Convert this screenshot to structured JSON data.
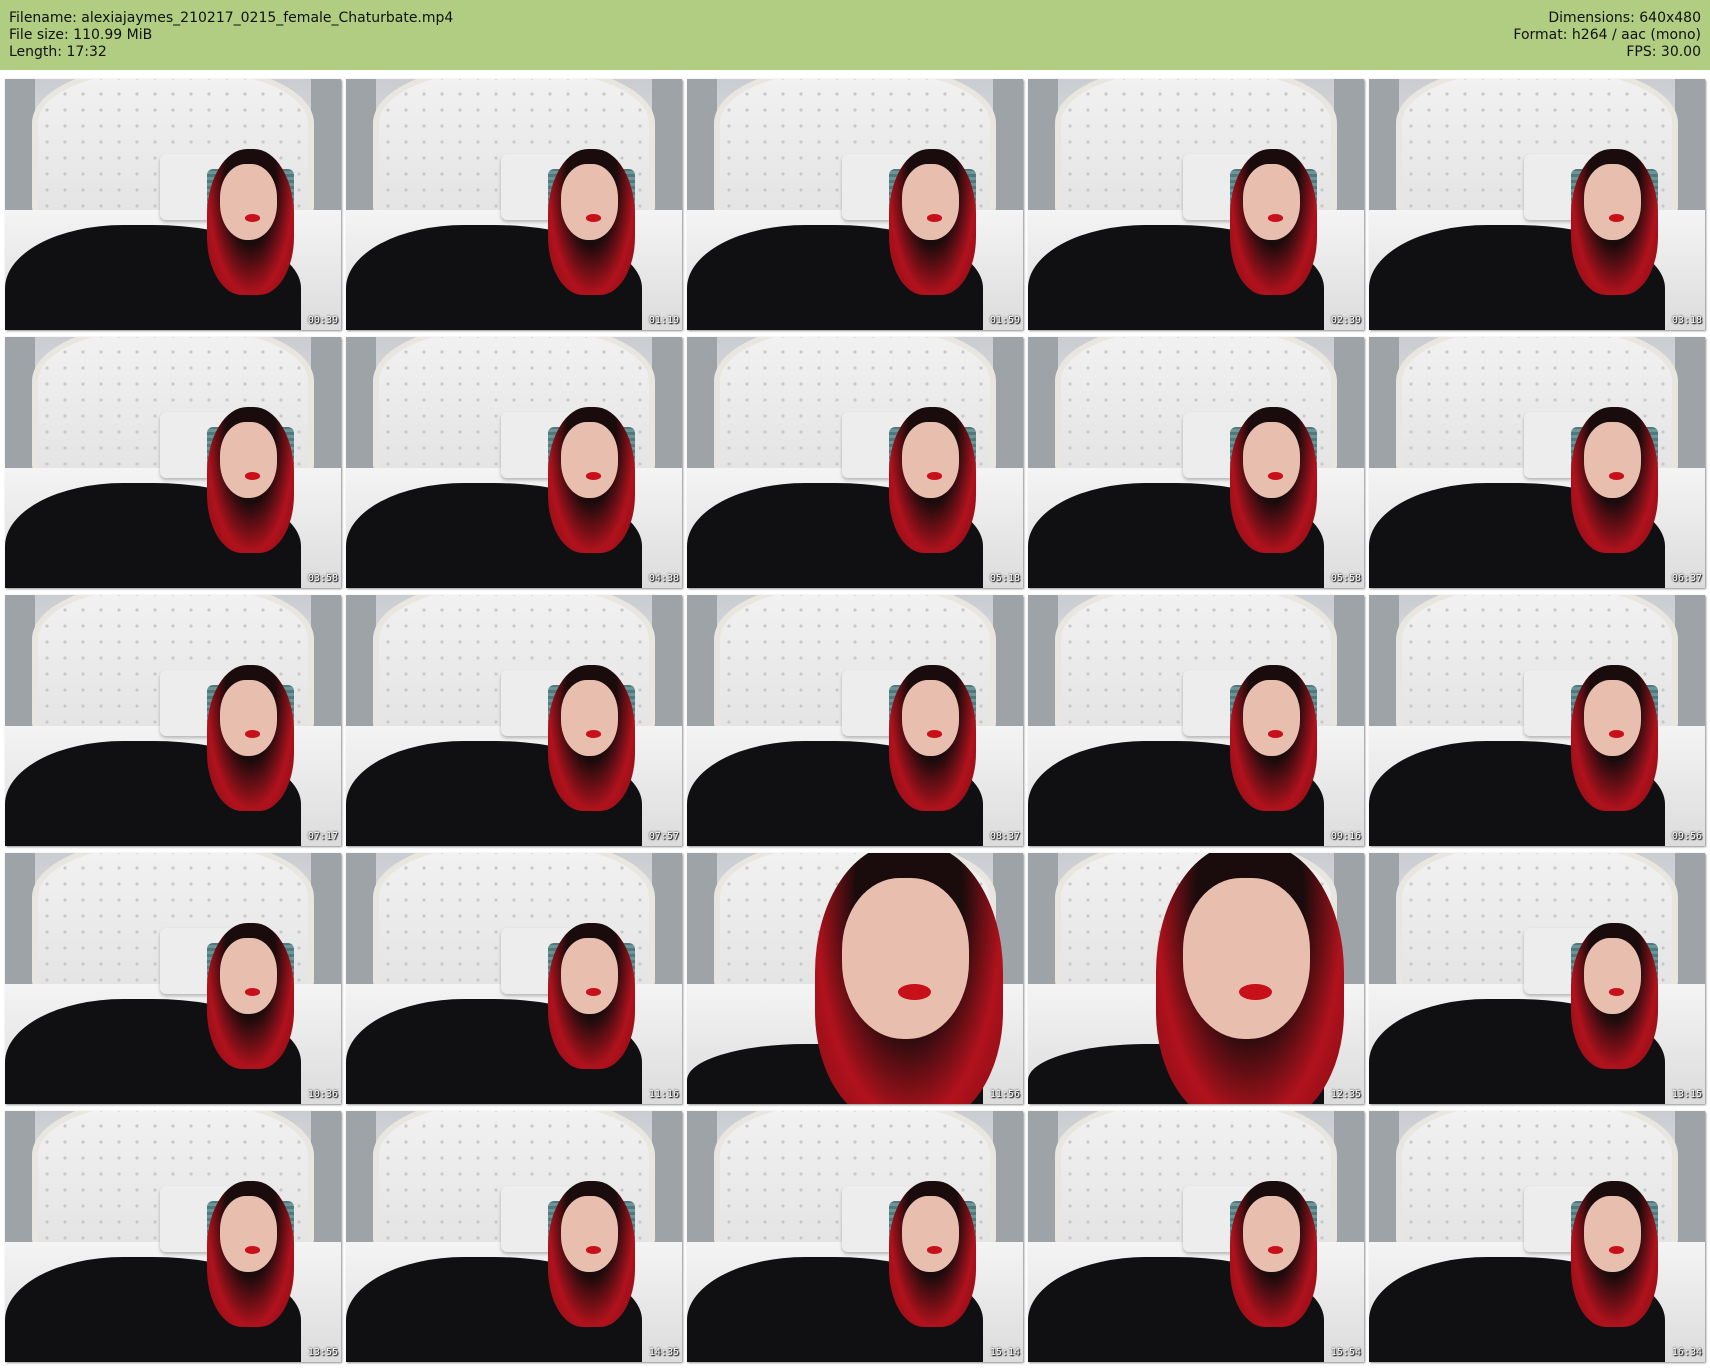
{
  "file_info": {
    "filename_line": "Filename: alexiajaymes_210217_0215_female_Chaturbate.mp4",
    "filesize_line": "File size: 110.99 MiB",
    "length_line": "Length: 17:32",
    "dimensions_line": "Dimensions: 640x480",
    "format_line": "Format: h264 / aac (mono)",
    "fps_line": "FPS: 30.00"
  },
  "colors": {
    "header_bg": "#b0cd82",
    "page_bg": "#ffffff"
  },
  "thumbnails": [
    {
      "timestamp": "00:39"
    },
    {
      "timestamp": "01:19"
    },
    {
      "timestamp": "01:59"
    },
    {
      "timestamp": "02:39"
    },
    {
      "timestamp": "03:18"
    },
    {
      "timestamp": "03:58"
    },
    {
      "timestamp": "04:38"
    },
    {
      "timestamp": "05:18"
    },
    {
      "timestamp": "05:58"
    },
    {
      "timestamp": "06:37"
    },
    {
      "timestamp": "07:17"
    },
    {
      "timestamp": "07:57"
    },
    {
      "timestamp": "08:37"
    },
    {
      "timestamp": "09:16"
    },
    {
      "timestamp": "09:56"
    },
    {
      "timestamp": "10:36"
    },
    {
      "timestamp": "11:16"
    },
    {
      "timestamp": "11:56"
    },
    {
      "timestamp": "12:35"
    },
    {
      "timestamp": "13:15"
    },
    {
      "timestamp": "13:55"
    },
    {
      "timestamp": "14:35"
    },
    {
      "timestamp": "15:14"
    },
    {
      "timestamp": "15:54"
    },
    {
      "timestamp": "16:34"
    }
  ]
}
